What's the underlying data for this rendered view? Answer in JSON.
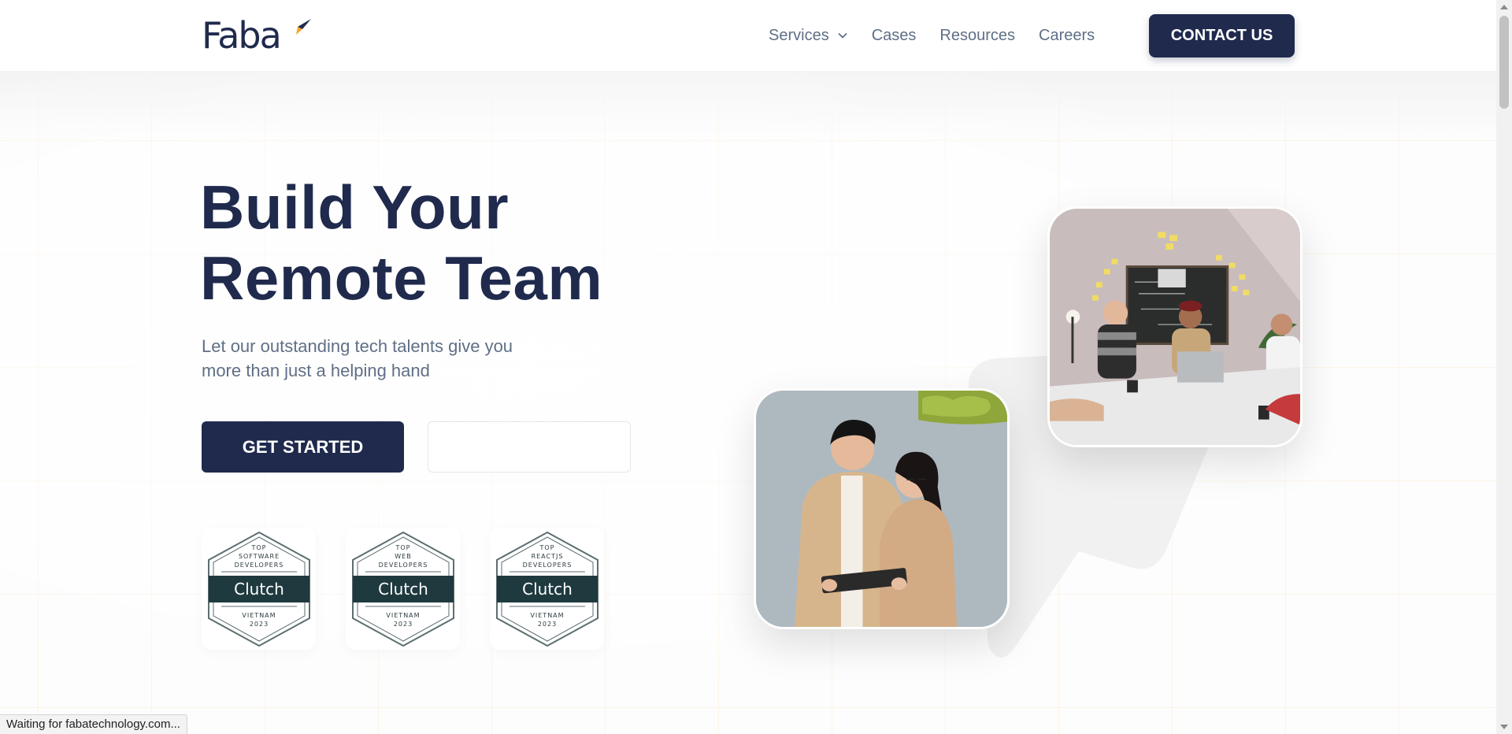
{
  "header": {
    "logo_text": "Faba",
    "nav": [
      {
        "label": "Services",
        "has_dropdown": true
      },
      {
        "label": "Cases",
        "has_dropdown": false
      },
      {
        "label": "Resources",
        "has_dropdown": false
      },
      {
        "label": "Careers",
        "has_dropdown": false
      }
    ],
    "contact_label": "CONTACT US"
  },
  "hero": {
    "title_line1": "Build Your",
    "title_line2": "Remote Team",
    "subtitle_line1": "Let our outstanding tech talents give you",
    "subtitle_line2": "more than just a helping hand",
    "cta_primary": "GET STARTED",
    "cta_secondary": ""
  },
  "badges": [
    {
      "top": "TOP",
      "line1": "SOFTWARE",
      "line2": "DEVELOPERS",
      "brand": "Clutch",
      "country": "VIETNAM",
      "year": "2023"
    },
    {
      "top": "TOP",
      "line1": "WEB",
      "line2": "DEVELOPERS",
      "brand": "Clutch",
      "country": "VIETNAM",
      "year": "2023"
    },
    {
      "top": "TOP",
      "line1": "REACTJS",
      "line2": "DEVELOPERS",
      "brand": "Clutch",
      "country": "VIETNAM",
      "year": "2023"
    }
  ],
  "status_bar": "Waiting for fabatechnology.com...",
  "colors": {
    "primary": "#1f2a4d",
    "accent_orange": "#f5a623",
    "muted_text": "#5f6f86"
  },
  "icons": {
    "services_dropdown": "chevron-down-icon",
    "logo_mark": "rocket-icon"
  }
}
